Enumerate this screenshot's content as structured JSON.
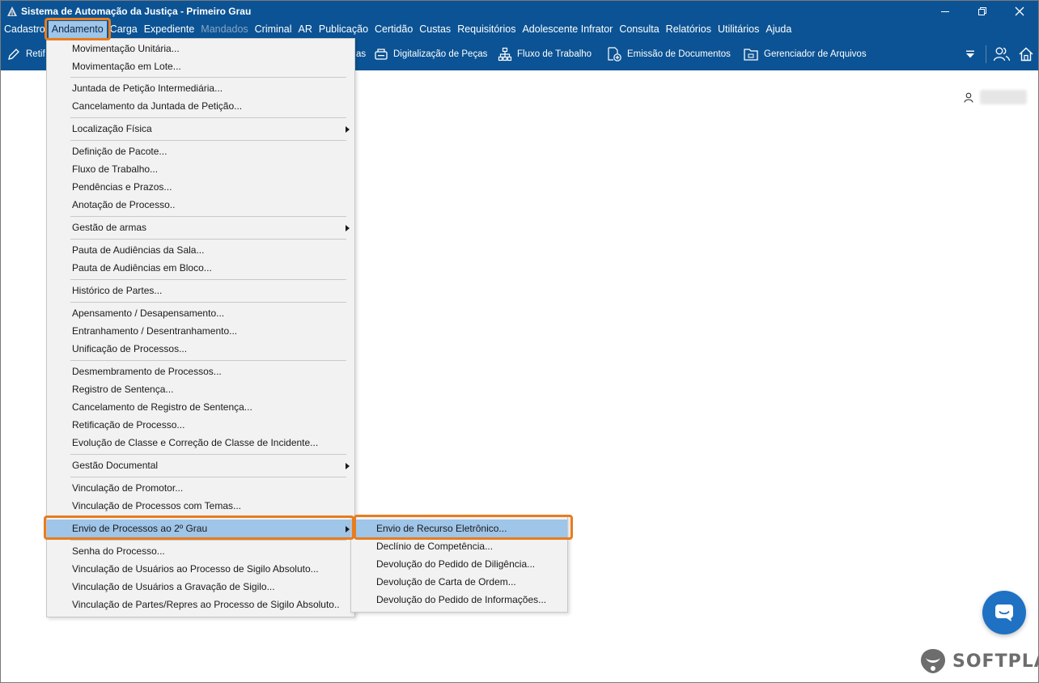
{
  "window": {
    "title": "Sistema de Automação da Justiça - Primeiro Grau"
  },
  "menubar": {
    "items": [
      {
        "label": "Cadastro",
        "state": "normal"
      },
      {
        "label": "Andamento",
        "state": "active"
      },
      {
        "label": "Carga",
        "state": "normal"
      },
      {
        "label": "Expediente",
        "state": "normal"
      },
      {
        "label": "Mandados",
        "state": "disabled"
      },
      {
        "label": "Criminal",
        "state": "normal"
      },
      {
        "label": "AR",
        "state": "normal"
      },
      {
        "label": "Publicação",
        "state": "normal"
      },
      {
        "label": "Certidão",
        "state": "normal"
      },
      {
        "label": "Custas",
        "state": "normal"
      },
      {
        "label": "Requisitórios",
        "state": "normal"
      },
      {
        "label": "Adolescente Infrator",
        "state": "normal"
      },
      {
        "label": "Consulta",
        "state": "normal"
      },
      {
        "label": "Relatórios",
        "state": "normal"
      },
      {
        "label": "Utilitários",
        "state": "normal"
      },
      {
        "label": "Ajuda",
        "state": "normal"
      }
    ]
  },
  "toolbar": {
    "retif_label": "Retif",
    "partial_label": "as",
    "digitalizacao_label": "Digitalização de Peças",
    "fluxo_label": "Fluxo de Trabalho",
    "emissao_label": "Emissão de Documentos",
    "gerenciador_label": "Gerenciador de Arquivos",
    "icons": {
      "retif": "edit-icon",
      "digitalizacao": "scanner-icon",
      "fluxo": "workflow-icon",
      "emissao": "document-add-icon",
      "gerenciador": "folder-icon",
      "dropdown": "caret-down-icon",
      "users": "users-icon",
      "home": "home-icon"
    }
  },
  "andamento_menu": {
    "items": [
      {
        "label": "Movimentação Unitária...",
        "submenu": false
      },
      {
        "label": "Movimentação em Lote...",
        "submenu": false
      },
      {
        "label": "Juntada de Petição Intermediária...",
        "submenu": false
      },
      {
        "label": "Cancelamento da Juntada de Petição...",
        "submenu": false
      },
      {
        "label": "Localização Física",
        "submenu": true
      },
      {
        "label": "Definição de Pacote...",
        "submenu": false
      },
      {
        "label": "Fluxo de Trabalho...",
        "submenu": false
      },
      {
        "label": "Pendências e Prazos...",
        "submenu": false
      },
      {
        "label": "Anotação de Processo..",
        "submenu": false
      },
      {
        "label": "Gestão de armas",
        "submenu": true
      },
      {
        "label": "Pauta de Audiências da Sala...",
        "submenu": false
      },
      {
        "label": "Pauta de Audiências em Bloco...",
        "submenu": false
      },
      {
        "label": "Histórico de Partes...",
        "submenu": false
      },
      {
        "label": "Apensamento / Desapensamento...",
        "submenu": false
      },
      {
        "label": "Entranhamento / Desentranhamento...",
        "submenu": false
      },
      {
        "label": "Unificação de Processos...",
        "submenu": false
      },
      {
        "label": "Desmembramento de Processos...",
        "submenu": false
      },
      {
        "label": "Registro de Sentença...",
        "submenu": false
      },
      {
        "label": "Cancelamento de Registro de Sentença...",
        "submenu": false
      },
      {
        "label": "Retificação de Processo...",
        "submenu": false
      },
      {
        "label": "Evolução de Classe e Correção de Classe de Incidente...",
        "submenu": false
      },
      {
        "label": "Gestão Documental",
        "submenu": true
      },
      {
        "label": "Vinculação de Promotor...",
        "submenu": false
      },
      {
        "label": "Vinculação de Processos com Temas...",
        "submenu": false
      },
      {
        "label": "Envio de Processos ao 2º Grau",
        "submenu": true,
        "highlighted": true
      },
      {
        "label": "Senha do Processo...",
        "submenu": false
      },
      {
        "label": "Vinculação de Usuários ao Processo de Sigilo Absoluto...",
        "submenu": false
      },
      {
        "label": "Vinculação de Usuários a Gravação de Sigilo...",
        "submenu": false
      },
      {
        "label": "Vinculação de Partes/Repres ao Processo de Sigilo Absoluto..",
        "submenu": false
      }
    ]
  },
  "envio_submenu": {
    "items": [
      {
        "label": "Envio de Recurso Eletrônico...",
        "highlighted": true
      },
      {
        "label": "Declínio de Competência..."
      },
      {
        "label": "Devolução do Pedido de Diligência..."
      },
      {
        "label": "Devolução de Carta de Ordem..."
      },
      {
        "label": "Devolução do Pedido de Informações..."
      }
    ]
  },
  "user": {
    "icon": "user-icon"
  },
  "chat": {
    "icon": "chat-icon"
  },
  "brand": {
    "name": "SOFTPLAN",
    "icon": "softplan-logo-icon"
  },
  "colors": {
    "primary": "#0b5394",
    "highlight": "#9fc5e8",
    "annotation": "#e87c1e",
    "menu_bg": "#f2f2f2",
    "chat": "#1f71c3"
  }
}
